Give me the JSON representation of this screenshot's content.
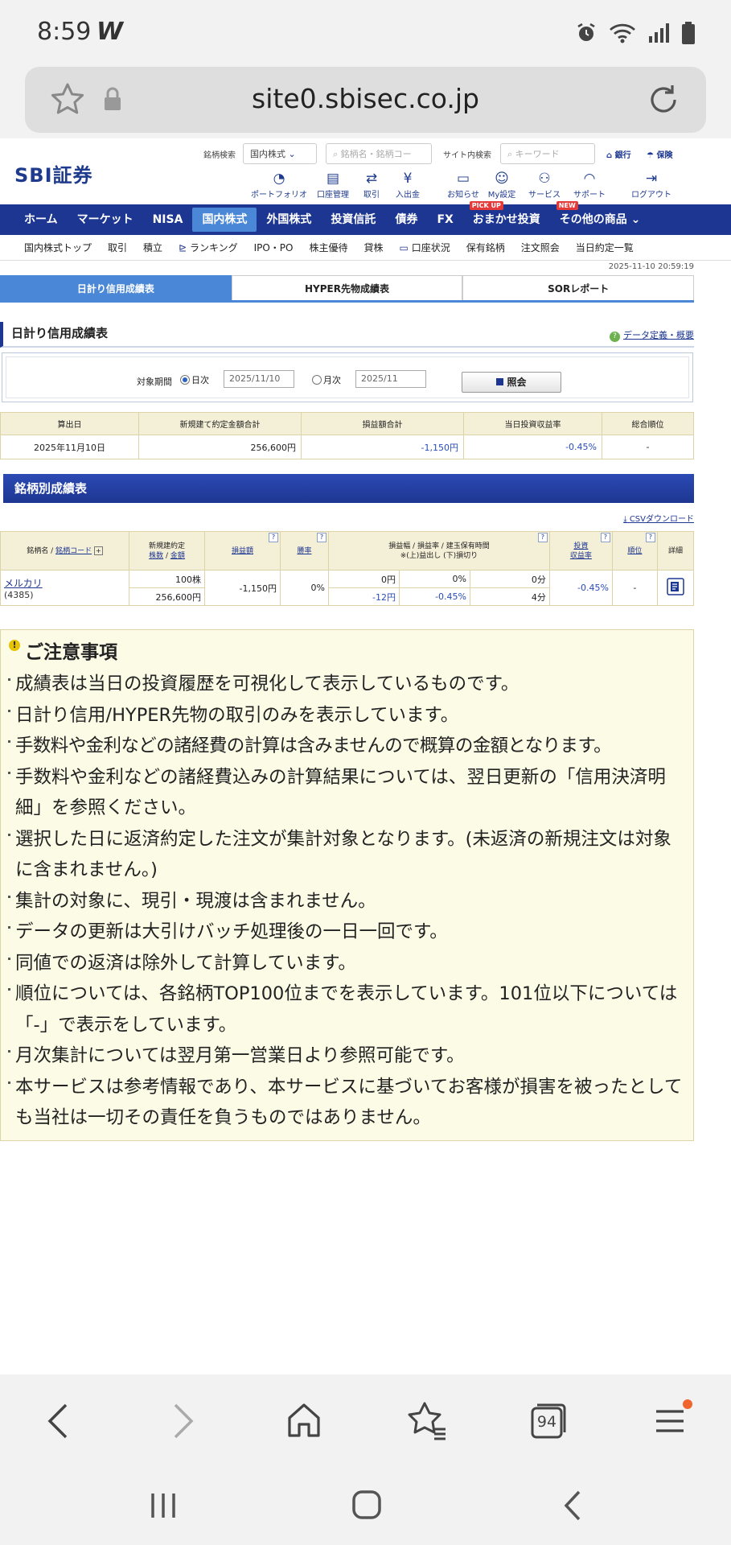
{
  "status": {
    "time": "8:59",
    "carrier": "W"
  },
  "browser": {
    "host": "site0.sbisec.co.jp",
    "tabs_count": "94"
  },
  "header": {
    "logo": "SBI証券",
    "search_label": "銘柄検索",
    "search_select": "国内株式",
    "search_placeholder": "銘柄名・銘柄コー",
    "site_search_label": "サイト内検索",
    "site_search_placeholder": "キーワード",
    "bank": "銀行",
    "insurance": "保険",
    "icons": [
      "ポートフォリオ",
      "口座管理",
      "取引",
      "入出金",
      "お知らせ",
      "My設定",
      "サービス",
      "サポート",
      "ログアウト"
    ]
  },
  "nav": {
    "items": [
      "ホーム",
      "マーケット",
      "NISA",
      "国内株式",
      "外国株式",
      "投資信託",
      "債券",
      "FX",
      "おまかせ投資",
      "その他の商品"
    ],
    "badge_pickup": "PICK UP",
    "badge_new": "NEW"
  },
  "subnav": [
    "国内株式トップ",
    "取引",
    "積立",
    "ランキング",
    "IPO・PO",
    "株主優待",
    "貸株",
    "口座状況",
    "保有銘柄",
    "注文照会",
    "当日約定一覧"
  ],
  "timestamp": "2025-11-10 20:59:19",
  "tabs": [
    "日計り信用成績表",
    "HYPER先物成績表",
    "SORレポート"
  ],
  "section_title": "日計り信用成績表",
  "data_def_link": "データ定義・概要",
  "period": {
    "label": "対象期間",
    "daily": "日次",
    "daily_value": "2025/11/10",
    "monthly": "月次",
    "monthly_value": "2025/11",
    "button": "照会"
  },
  "summary": {
    "headers": [
      "算出日",
      "新規建て約定金額合計",
      "損益額合計",
      "当日投資収益率",
      "総合順位"
    ],
    "row": [
      "2025年11月10日",
      "256,600円",
      "-1,150円",
      "-0.45%",
      "-"
    ]
  },
  "brand_section_title": "銘柄別成績表",
  "csv_link": "CSVダウンロード",
  "brand_table": {
    "h_name": "銘柄名 /",
    "h_code": "銘柄コード",
    "h_new1": "新規建約定",
    "h_new2a": "株数",
    "h_new2b": "金額",
    "h_pl": "損益額",
    "h_win": "勝率",
    "h_range1": "損益幅 / 損益率 / 建玉保有時間",
    "h_range2": "※(上)益出し (下)損切り",
    "h_ret1": "投資",
    "h_ret2": "収益率",
    "h_rank": "順位",
    "h_detail": "詳細",
    "row": {
      "name": "メルカリ",
      "code": "(4385)",
      "shares": "100株",
      "amount": "256,600円",
      "pl": "-1,150円",
      "win": "0%",
      "up_range": "0円",
      "up_rate": "0%",
      "up_time": "0分",
      "dn_range": "-12円",
      "dn_rate": "-0.45%",
      "dn_time": "4分",
      "ret": "-0.45%",
      "rank": "-"
    }
  },
  "notice": {
    "title": "ご注意事項",
    "items": [
      "成績表は当日の投資履歴を可視化して表示しているものです。",
      "日計り信用/HYPER先物の取引のみを表示しています。",
      "手数料や金利などの諸経費の計算は含みませんので概算の金額となります。",
      "手数料や金利などの諸経費込みの計算結果については、翌日更新の「信用決済明細」を参照ください。",
      "選択した日に返済約定した注文が集計対象となります。(未返済の新規注文は対象に含まれません。)",
      "集計の対象に、現引・現渡は含まれません。",
      "データの更新は大引けバッチ処理後の一日一回です。",
      "同値での返済は除外して計算しています。",
      "順位については、各銘柄TOP100位までを表示しています。101位以下については「-」で表示をしています。",
      "月次集計については翌月第一営業日より参照可能です。",
      "本サービスは参考情報であり、本サービスに基づいてお客様が損害を被ったとしても当社は一切その責任を負うものではありません。"
    ]
  }
}
